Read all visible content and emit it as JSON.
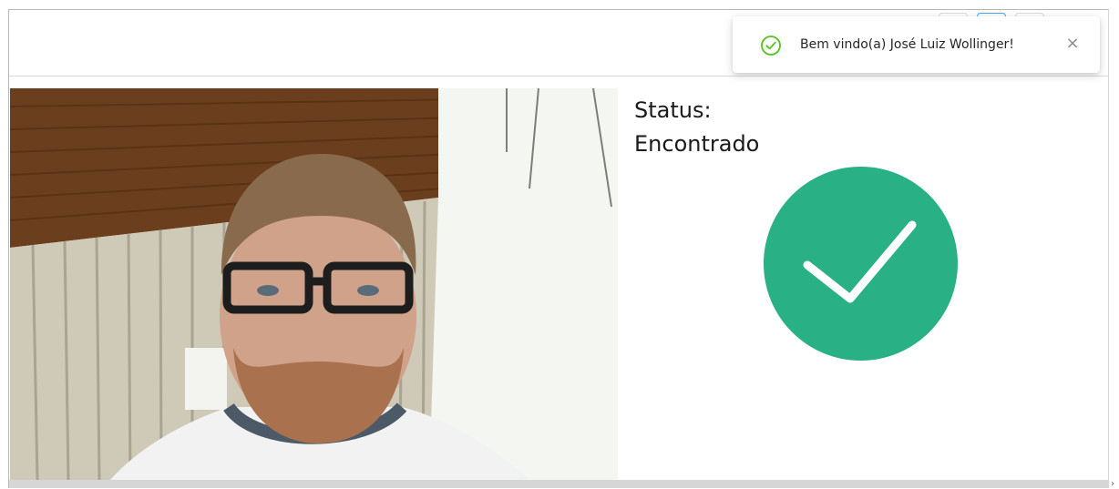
{
  "status": {
    "label": "Status:",
    "value": "Encontrado",
    "badge_icon": "check-icon",
    "badge_color": "#2ab085"
  },
  "notification": {
    "message": "Bem vindo(a) José Luiz Wollinger!",
    "icon": "check-circle-icon",
    "icon_color": "#52c41a",
    "close_label": "×",
    "close_icon": "close-icon"
  },
  "camera": {
    "description_icon": "camera-feed"
  },
  "scrollbar": {
    "arrow": "›"
  }
}
